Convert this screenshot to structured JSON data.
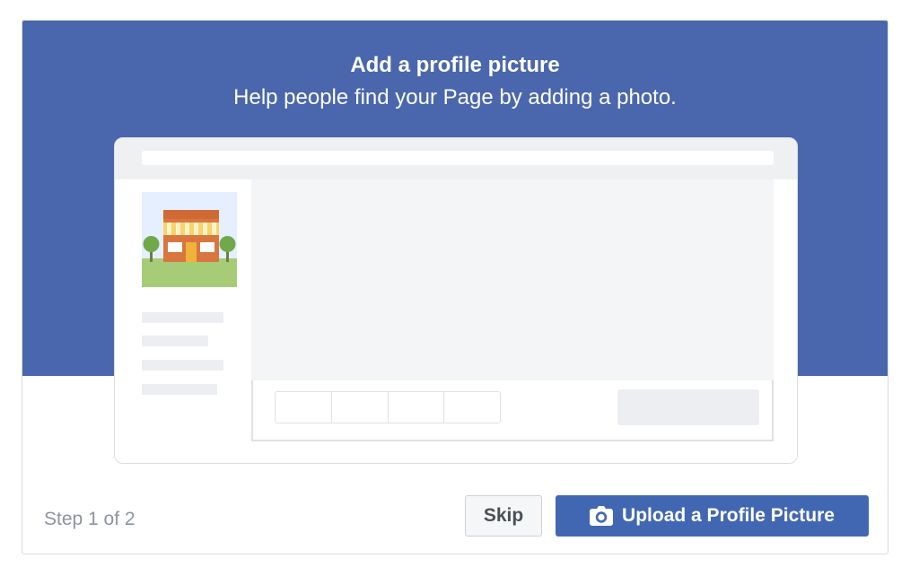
{
  "dialog": {
    "title": "Add a profile picture",
    "subtitle": "Help people find your Page by adding a photo."
  },
  "footer": {
    "step": "Step 1 of 2",
    "skip_label": "Skip",
    "upload_label": "Upload a Profile Picture"
  },
  "icons": {
    "upload": "camera-icon",
    "illustration": "storefront-illustration"
  },
  "colors": {
    "banner": "#4a67ad",
    "primary_button": "#4267b2",
    "secondary_text": "#8d949e"
  }
}
